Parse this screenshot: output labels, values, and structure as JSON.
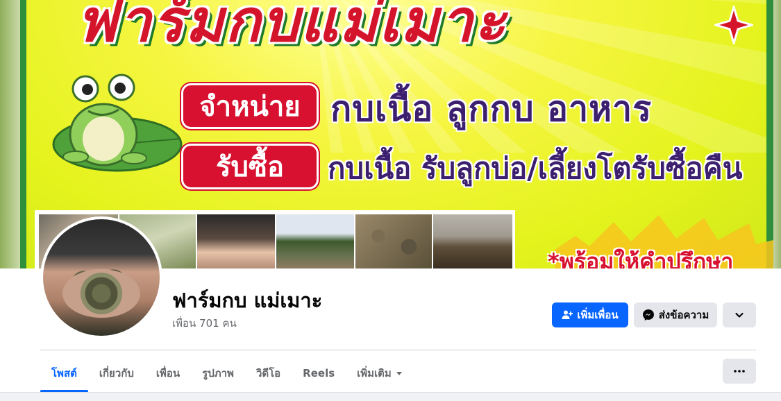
{
  "cover": {
    "title": "ฟาร์มกบแม่เมาะ",
    "sell_label": "จำหน่าย",
    "sell_items": "กบเนื้อ  ลูกกบ  อาหาร",
    "buy_label": "รับซื้อ",
    "buy_items": "กบเนื้อ  รับลูกบ่อ/เลี้ยงโตรับซื้อคืน",
    "advice": "*พร้อมให้คำปรึกษา"
  },
  "profile": {
    "name": "ฟาร์มกบ แม่เมาะ",
    "friends": "เพื่อน 701 คน"
  },
  "actions": {
    "add_friend": "เพิ่มเพื่อน",
    "message": "ส่งข้อความ"
  },
  "tabs": [
    {
      "label": "โพสต์",
      "active": true
    },
    {
      "label": "เกี่ยวกับ",
      "active": false
    },
    {
      "label": "เพื่อน",
      "active": false
    },
    {
      "label": "รูปภาพ",
      "active": false
    },
    {
      "label": "วิดีโอ",
      "active": false
    },
    {
      "label": "Reels",
      "active": false
    },
    {
      "label": "เพิ่มเติม",
      "active": false
    }
  ],
  "colors": {
    "accent": "#0866ff",
    "button_gray": "#e4e6eb",
    "cover_red": "#d7112f",
    "cover_purple": "#3c1f6e",
    "cover_yellow": "#e4f31c"
  },
  "icons": {
    "add_friend": "person-plus-icon",
    "message": "messenger-icon",
    "more_profile": "chevron-down-icon",
    "more_tabs": "more-dots-icon",
    "see_more": "caret-down-icon"
  }
}
